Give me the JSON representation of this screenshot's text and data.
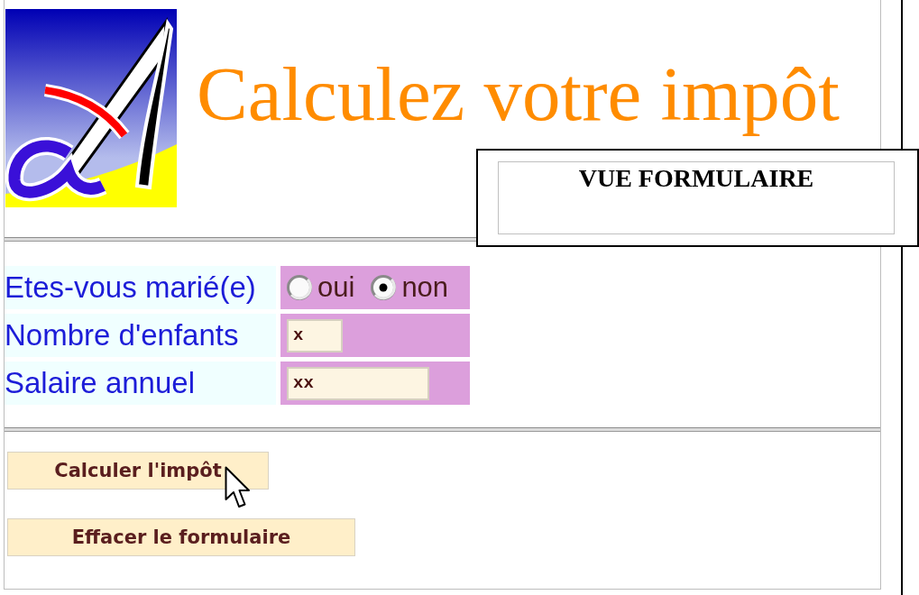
{
  "header": {
    "title": "Calculez votre impôt"
  },
  "view_label": {
    "title": "VUE FORMULAIRE"
  },
  "form": {
    "rows": [
      {
        "kind": "radio",
        "label": "Etes-vous marié(e)",
        "options": [
          {
            "label": "oui",
            "selected": false
          },
          {
            "label": "non",
            "selected": true
          }
        ]
      },
      {
        "kind": "text",
        "label": "Nombre d'enfants",
        "value": "x"
      },
      {
        "kind": "text",
        "label": "Salaire annuel",
        "value": "xx"
      }
    ]
  },
  "buttons": [
    {
      "label": "Calculer l'impôt"
    },
    {
      "label": "Effacer le formulaire"
    }
  ]
}
